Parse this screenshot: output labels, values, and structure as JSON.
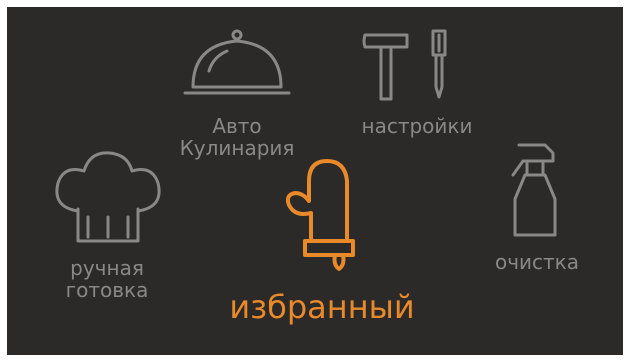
{
  "menu": {
    "auto_cooking": {
      "line1": "Авто",
      "line2": "Кулинария",
      "icon": "cloche-icon"
    },
    "settings": {
      "label": "настройки",
      "icon": "tools-icon"
    },
    "manual_cooking": {
      "line1": "ручная",
      "line2": "готовка",
      "icon": "chef-hat-icon"
    },
    "favorites": {
      "label": "избранный",
      "icon": "oven-mitt-icon",
      "selected": true
    },
    "cleaning": {
      "label": "очистка",
      "icon": "spray-bottle-icon"
    }
  },
  "colors": {
    "background": "#2b2a29",
    "inactive": "#8a8886",
    "active": "#e8892a"
  }
}
